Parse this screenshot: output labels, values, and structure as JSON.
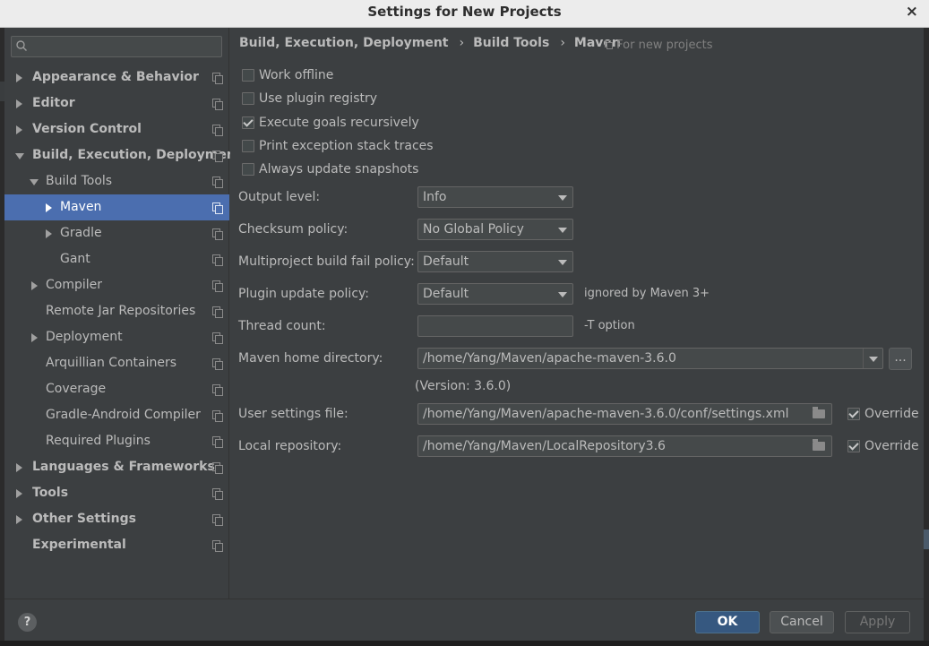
{
  "window": {
    "title": "Settings for New Projects",
    "close_glyph": "×"
  },
  "search": {
    "placeholder": ""
  },
  "sidebar": {
    "items": [
      {
        "label": "Appearance & Behavior"
      },
      {
        "label": "Editor"
      },
      {
        "label": "Version Control"
      },
      {
        "label": "Build, Execution, Deployment"
      },
      {
        "label": "Build Tools"
      },
      {
        "label": "Maven"
      },
      {
        "label": "Gradle"
      },
      {
        "label": "Gant"
      },
      {
        "label": "Compiler"
      },
      {
        "label": "Remote Jar Repositories"
      },
      {
        "label": "Deployment"
      },
      {
        "label": "Arquillian Containers"
      },
      {
        "label": "Coverage"
      },
      {
        "label": "Gradle-Android Compiler"
      },
      {
        "label": "Required Plugins"
      },
      {
        "label": "Languages & Frameworks"
      },
      {
        "label": "Tools"
      },
      {
        "label": "Other Settings"
      },
      {
        "label": "Experimental"
      }
    ]
  },
  "breadcrumb": {
    "parts": [
      "Build, Execution, Deployment",
      "Build Tools",
      "Maven"
    ],
    "separator": "›",
    "scope_note": "For new projects"
  },
  "options": {
    "work_offline": {
      "label": "Work offline",
      "checked": false
    },
    "use_plugin_registry": {
      "label": "Use plugin registry",
      "checked": false
    },
    "execute_goals_recursively": {
      "label": "Execute goals recursively",
      "checked": true
    },
    "print_exception_stack_traces": {
      "label": "Print exception stack traces",
      "checked": false
    },
    "always_update_snapshots": {
      "label": "Always update snapshots",
      "checked": false
    }
  },
  "form": {
    "output_level": {
      "label": "Output level:",
      "value": "Info"
    },
    "checksum_policy": {
      "label": "Checksum policy:",
      "value": "No Global Policy"
    },
    "multiproject_fail_policy": {
      "label": "Multiproject build fail policy:",
      "value": "Default"
    },
    "plugin_update_policy": {
      "label": "Plugin update policy:",
      "value": "Default",
      "note": "ignored by Maven 3+"
    },
    "thread_count": {
      "label": "Thread count:",
      "value": "",
      "note": "-T option"
    },
    "maven_home": {
      "label": "Maven home directory:",
      "value": "/home/Yang/Maven/apache-maven-3.6.0",
      "browse_label": "...",
      "version": "(Version: 3.6.0)"
    },
    "user_settings": {
      "label": "User settings file:",
      "value": "/home/Yang/Maven/apache-maven-3.6.0/conf/settings.xml",
      "override_label": "Override",
      "override_checked": true
    },
    "local_repository": {
      "label": "Local repository:",
      "value": "/home/Yang/Maven/LocalRepository3.6",
      "override_label": "Override",
      "override_checked": true
    }
  },
  "footer": {
    "help_label": "?",
    "ok_label": "OK",
    "cancel_label": "Cancel",
    "apply_label": "Apply"
  },
  "colors": {
    "background": "#3c3f41",
    "selection": "#4b6eaf",
    "ok_button": "#365880",
    "title_bar": "#ececec"
  }
}
